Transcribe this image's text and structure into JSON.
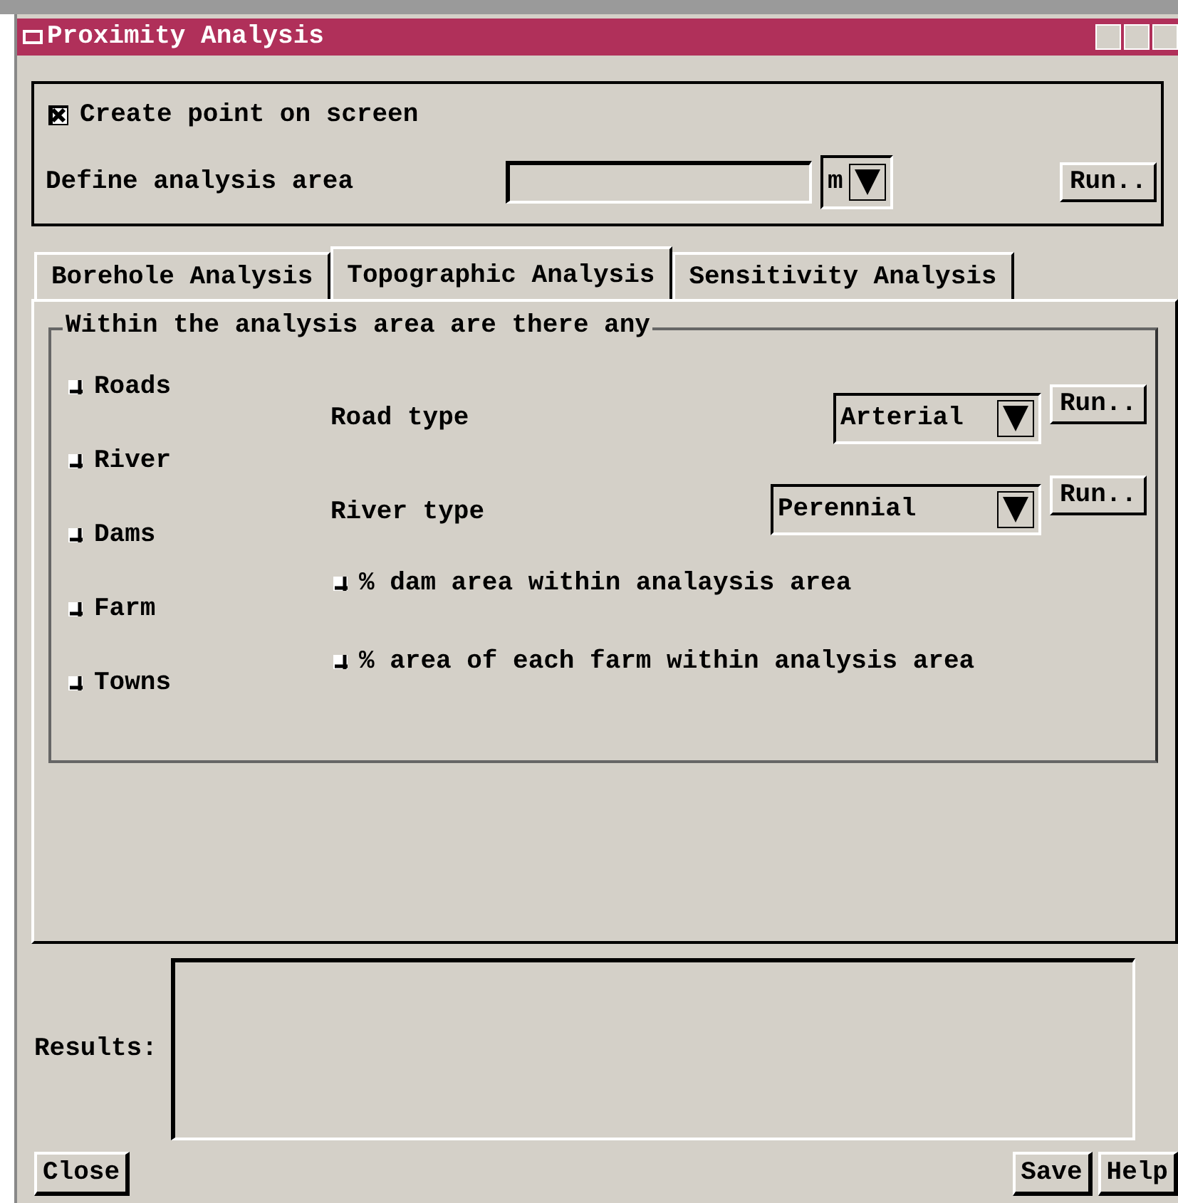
{
  "window": {
    "title": "Proximity Analysis"
  },
  "top": {
    "create_point": {
      "label": "Create point on screen",
      "checked": true
    },
    "area_label": "Define analysis area",
    "unit": "m",
    "run": "Run.."
  },
  "tabs": [
    {
      "label": "Borehole Analysis",
      "selected": false
    },
    {
      "label": "Topographic Analysis",
      "selected": true
    },
    {
      "label": "Sensitivity Analysis",
      "selected": false
    }
  ],
  "group": {
    "title": "Within the analysis area are there any",
    "features": [
      {
        "label": "Roads",
        "checked": false
      },
      {
        "label": "River",
        "checked": false
      },
      {
        "label": "Dams",
        "checked": false
      },
      {
        "label": "Farm",
        "checked": false
      },
      {
        "label": "Towns",
        "checked": false
      }
    ],
    "road": {
      "label": "Road type",
      "value": "Arterial",
      "run": "Run.."
    },
    "river": {
      "label": "River type",
      "value": "Perennial",
      "run": "Run.."
    },
    "options": [
      {
        "label": "% dam area within analaysis area",
        "checked": false
      },
      {
        "label": "% area of each farm within analysis area",
        "checked": false
      }
    ]
  },
  "results": {
    "label": "Results:"
  },
  "buttons": {
    "left": [
      "Close"
    ],
    "right": [
      "Save",
      "Help"
    ]
  }
}
